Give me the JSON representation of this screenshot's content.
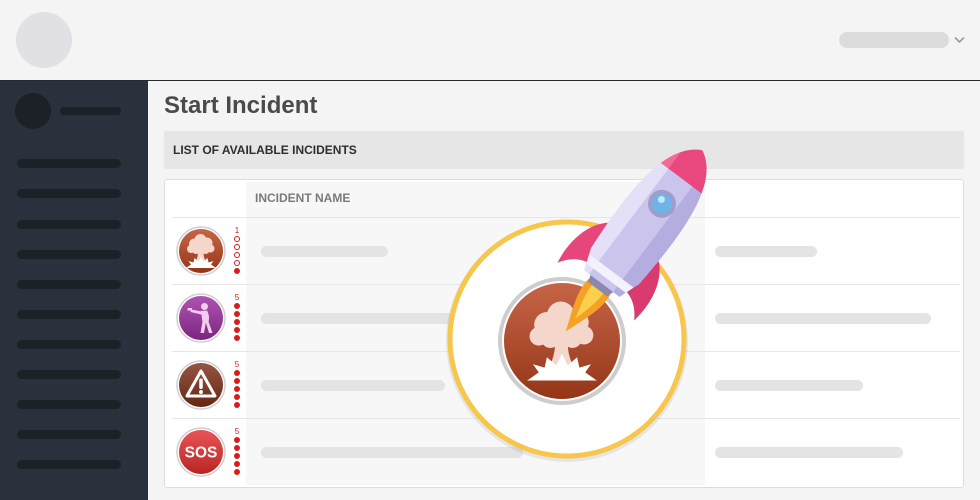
{
  "topbar": {
    "user_menu_icon": "chevron-down-icon"
  },
  "page": {
    "title": "Start Incident"
  },
  "incidents_panel": {
    "heading": "LIST OF AVAILABLE INCIDENTS",
    "column_name": "INCIDENT NAME",
    "severity_max": 5,
    "rows": [
      {
        "icon": "explosion-icon",
        "color": "#b9421d",
        "severity": 1
      },
      {
        "icon": "gunman-icon",
        "color": "#9b2d9f",
        "severity": 5
      },
      {
        "icon": "warning-icon",
        "color": "#7d2f18",
        "severity": 5
      },
      {
        "icon": "sos-icon",
        "color": "#e42e2e",
        "severity": 5,
        "icon_text": "SOS"
      }
    ]
  },
  "highlight": {
    "icon": "explosion-icon",
    "color": "#b9421d",
    "ring_color": "#f7c64a",
    "decoration_icon": "rocket-icon"
  },
  "colors": {
    "sidebar": "#2b313c",
    "severity": "#d81b1b"
  }
}
